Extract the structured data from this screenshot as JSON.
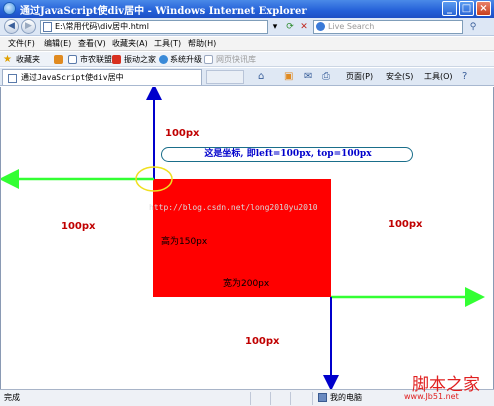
{
  "window": {
    "title": "通过JavaScript使div居中 - Windows Internet Explorer",
    "controls": {
      "minimize": "_",
      "maximize": "□",
      "close": "×"
    }
  },
  "address_bar": {
    "url": "E:\\常用代码\\div居中.html",
    "search_placeholder": "Live Search"
  },
  "menu": [
    "文件(F)",
    "编辑(E)",
    "查看(V)",
    "收藏夹(A)",
    "工具(T)",
    "帮助(H)"
  ],
  "favorites": {
    "label": "收藏夹",
    "items": [
      "市农联盟",
      "振动之家",
      "系统升级",
      "网页快讯库"
    ]
  },
  "tab": {
    "title": "通过JavaScript使div居中"
  },
  "commands": {
    "page": "页面(P)",
    "safety": "安全(S)",
    "tools": "工具(O)"
  },
  "content": {
    "callout": "这是坐标, 即left=100px, top=100px",
    "watermark": "http://blog.csdn.net/long2010yu2010",
    "height_label": "高为150px",
    "width_label": "宽为200px",
    "top_margin": "100px",
    "left_margin": "100px",
    "right_margin": "100px",
    "bottom_margin": "100px"
  },
  "status": {
    "left": "完成",
    "zone": "我的电脑"
  },
  "branding": {
    "logo": "脚本之家",
    "url": "www.Jb51.net"
  },
  "colors": {
    "box": "#ff0000",
    "blue_arrow": "#0000cc",
    "green_arrow": "#33ff33",
    "label": "#c00000"
  }
}
